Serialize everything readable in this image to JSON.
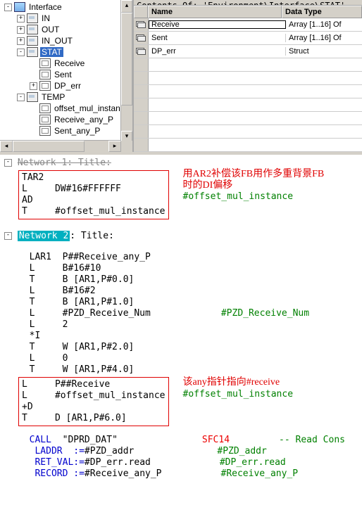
{
  "path_bar": "Contents Of: 'Environment\\Interface\\STAT'",
  "grid": {
    "headers": [
      "",
      "Name",
      "Data Type"
    ],
    "rows": [
      {
        "name": "Receive",
        "type": "Array [1..16] Of",
        "selected": true
      },
      {
        "name": "Sent",
        "type": "Array [1..16] Of"
      },
      {
        "name": "DP_err",
        "type": "Struct"
      }
    ]
  },
  "tree": {
    "root": "Interface",
    "items": [
      {
        "indent": 0,
        "exp": "-",
        "icon": "iface",
        "label": "Interface"
      },
      {
        "indent": 1,
        "exp": "+",
        "icon": "io",
        "label": "IN"
      },
      {
        "indent": 1,
        "exp": "+",
        "icon": "io",
        "label": "OUT"
      },
      {
        "indent": 1,
        "exp": "+",
        "icon": "io",
        "label": "IN_OUT"
      },
      {
        "indent": 1,
        "exp": "-",
        "icon": "io",
        "label": "STAT",
        "selected": true
      },
      {
        "indent": 2,
        "exp": "",
        "icon": "var",
        "label": "Receive"
      },
      {
        "indent": 2,
        "exp": "",
        "icon": "var",
        "label": "Sent"
      },
      {
        "indent": 2,
        "exp": "+",
        "icon": "var",
        "label": "DP_err"
      },
      {
        "indent": 1,
        "exp": "-",
        "icon": "io",
        "label": "TEMP"
      },
      {
        "indent": 2,
        "exp": "",
        "icon": "var",
        "label": "offset_mul_instance"
      },
      {
        "indent": 2,
        "exp": "",
        "icon": "var",
        "label": "Receive_any_P"
      },
      {
        "indent": 2,
        "exp": "",
        "icon": "var",
        "label": "Sent_any_P"
      }
    ]
  },
  "nets": {
    "n1": {
      "title": "Network 1: Title:",
      "code_lines": [
        "TAR2",
        "L     DW#16#FFFFFF",
        "AD",
        "T     #offset_mul_instance"
      ],
      "annot1": "用AR2补偿该FB用作多重背景FB",
      "annot2": "时的DI偏移",
      "sym": "#offset_mul_instance"
    },
    "n2": {
      "expander": "-",
      "label": "Network 2",
      "title_suffix": ": Title:",
      "code_top": "  LAR1  P##Receive_any_P\n  L     B#16#10\n  T     B [AR1,P#0.0]\n  L     B#16#2\n  T     B [AR1,P#1.0]",
      "line_pzd_l": "  L     #PZD_Receive_Num",
      "sym_pzd": "#PZD_Receive_Num",
      "code_mid": "  L     2\n  *I\n  T     W [AR1,P#2.0]\n  L     0\n  T     W [AR1,P#4.0]",
      "box_lines": [
        "L     P##Receive",
        "L     #offset_mul_instance",
        "+D",
        "T     D [AR1,P#6.0]"
      ],
      "box_annot": "该any指针指向#receive",
      "box_sym": "#offset_mul_instance",
      "call_kw": "  CALL  ",
      "call_target": "\"DPRD_DAT\"",
      "call_sfc": "SFC14",
      "call_cmt": "-- Read Cons",
      "p_laddr_k": "   LADDR  :=",
      "p_laddr_v": "#PZD_addr",
      "p_laddr_s": "#PZD_addr",
      "p_ret_k": "   RET_VAL:=",
      "p_ret_v": "#DP_err.read",
      "p_ret_s": "#DP_err.read",
      "p_rec_k": "   RECORD :=",
      "p_rec_v": "#Receive_any_P",
      "p_rec_s": "#Receive_any_P"
    }
  },
  "chart_data": null
}
